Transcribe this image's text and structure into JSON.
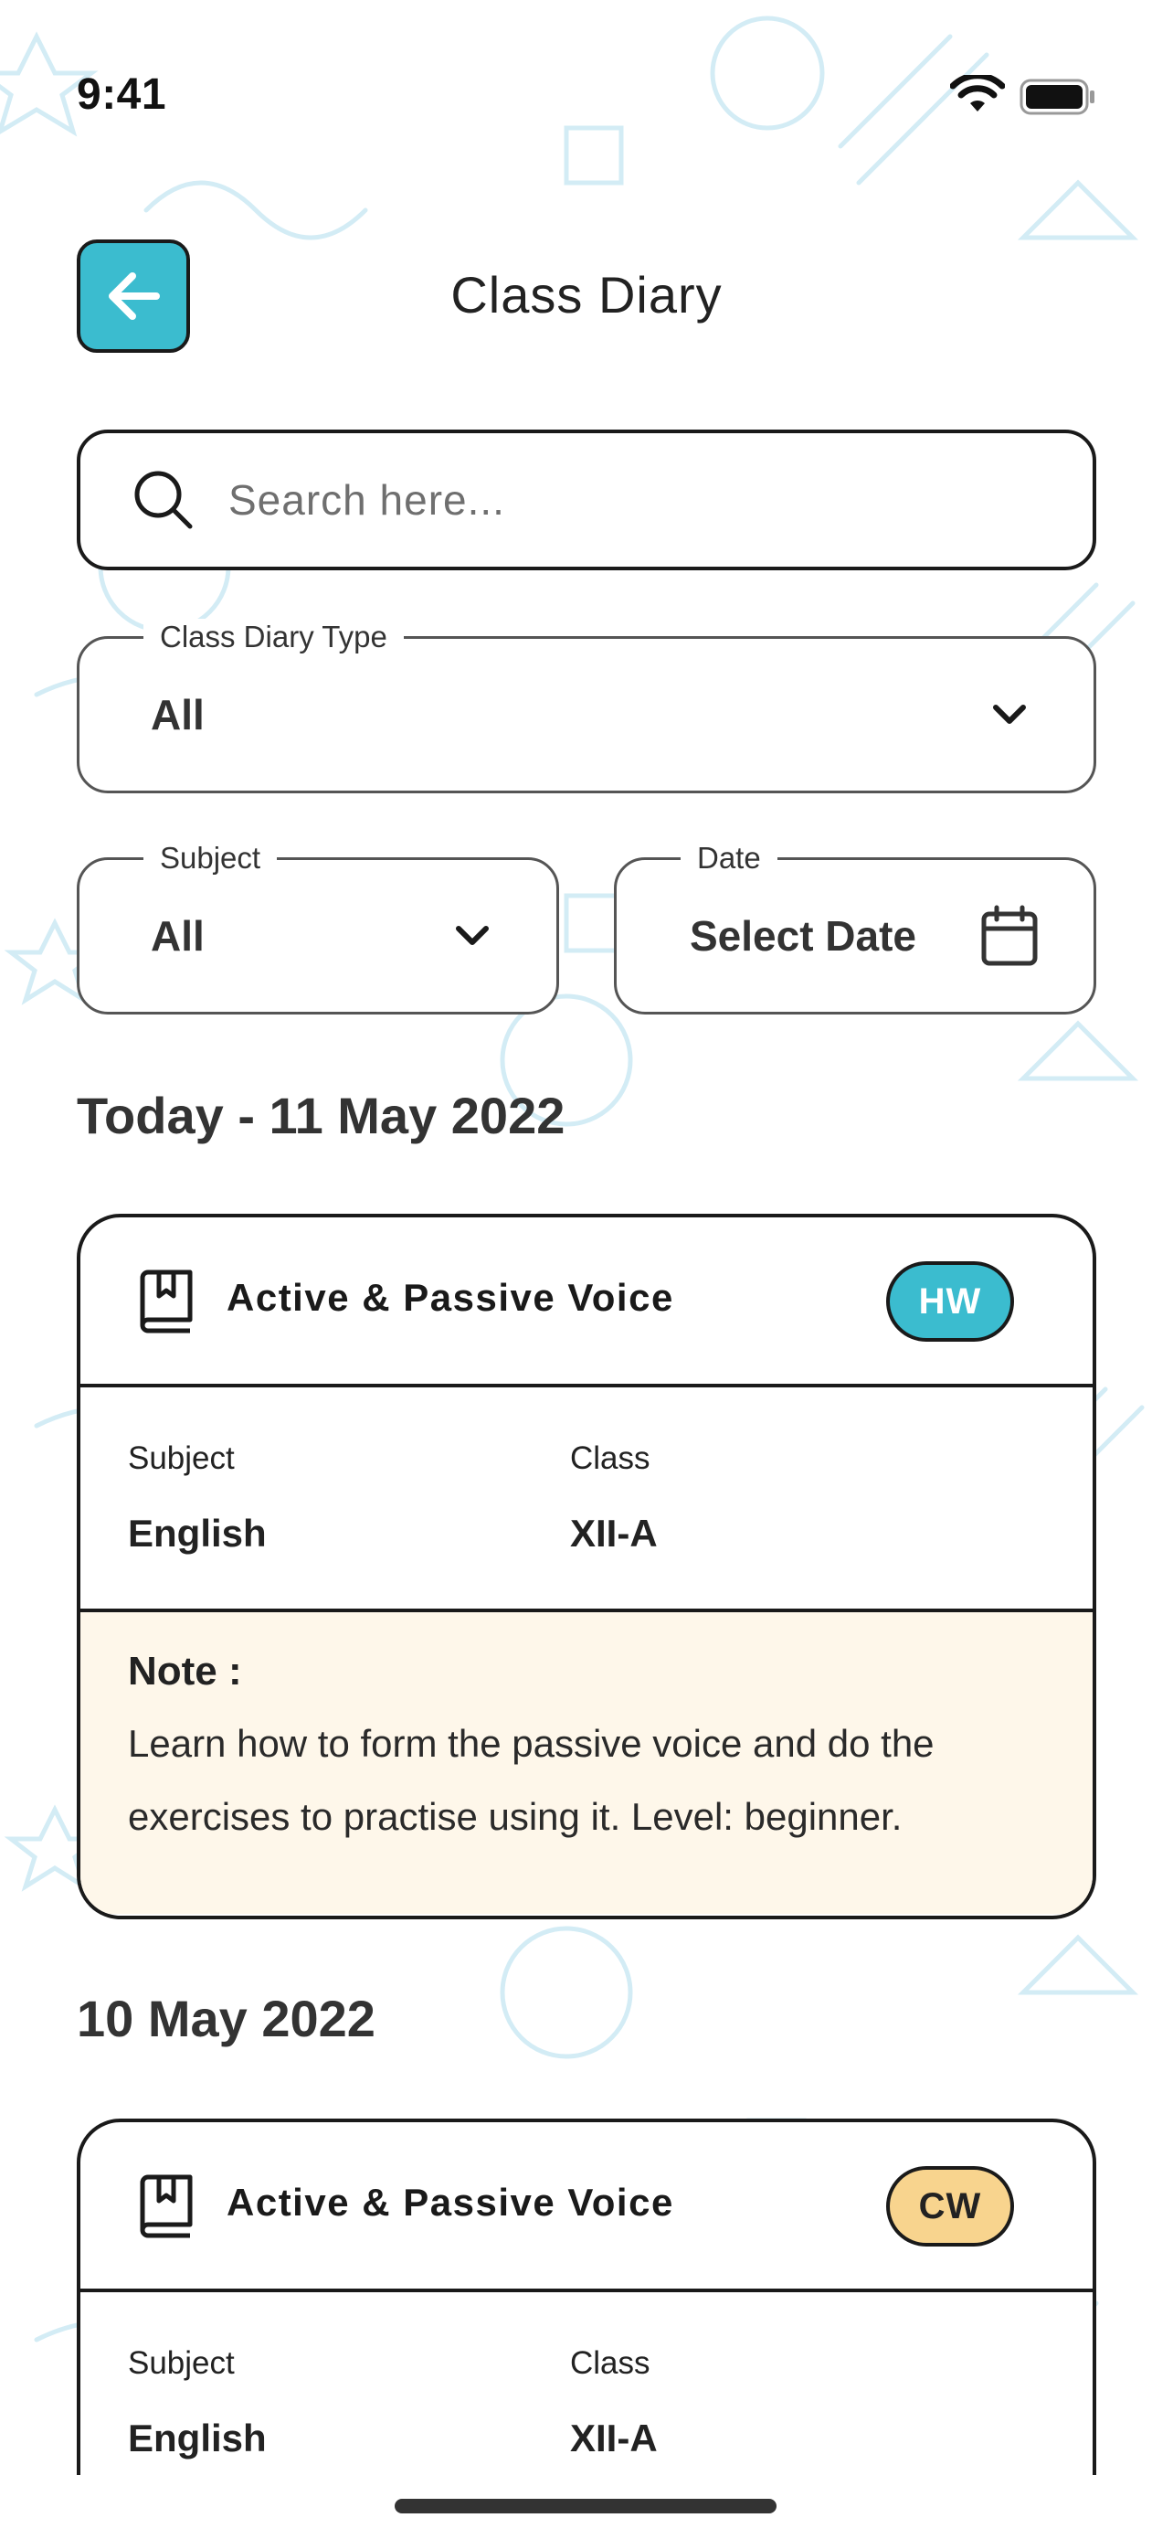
{
  "status_bar": {
    "time": "9:41",
    "wifi_icon": "wifi-icon",
    "battery_icon": "battery-icon"
  },
  "header": {
    "title": "Class Diary",
    "back_icon": "arrow-left-icon"
  },
  "search": {
    "placeholder": "Search here...",
    "value": "",
    "icon": "search-icon"
  },
  "filters": {
    "diary_type": {
      "label": "Class Diary Type",
      "value": "All",
      "icon": "chevron-down-icon"
    },
    "subject": {
      "label": "Subject",
      "value": "All",
      "icon": "chevron-down-icon"
    },
    "date": {
      "label": "Date",
      "value": "Select Date",
      "icon": "calendar-icon"
    }
  },
  "sections": [
    {
      "heading": "Today - 11 May 2022",
      "entries": [
        {
          "icon": "book-icon",
          "title": "Active & Passive Voice",
          "badge": "HW",
          "subject_label": "Subject",
          "subject": "English",
          "class_label": "Class",
          "class": "XII-A",
          "note_label": "Note :",
          "note": "Learn how to form the passive voice and do the exercises to practise using it. Level: beginner."
        }
      ]
    },
    {
      "heading": "10 May 2022",
      "entries": [
        {
          "icon": "book-icon",
          "title": "Active & Passive Voice",
          "badge": "CW",
          "subject_label": "Subject",
          "subject": "English",
          "class_label": "Class",
          "class": "XII-A"
        }
      ]
    }
  ],
  "colors": {
    "accent": "#3bbccf",
    "hw_badge": "#3bbccf",
    "cw_badge": "#f8d48e",
    "note_background": "#fef7ea",
    "border": "#1a1a1a",
    "doodle": "#cfe9f3"
  }
}
